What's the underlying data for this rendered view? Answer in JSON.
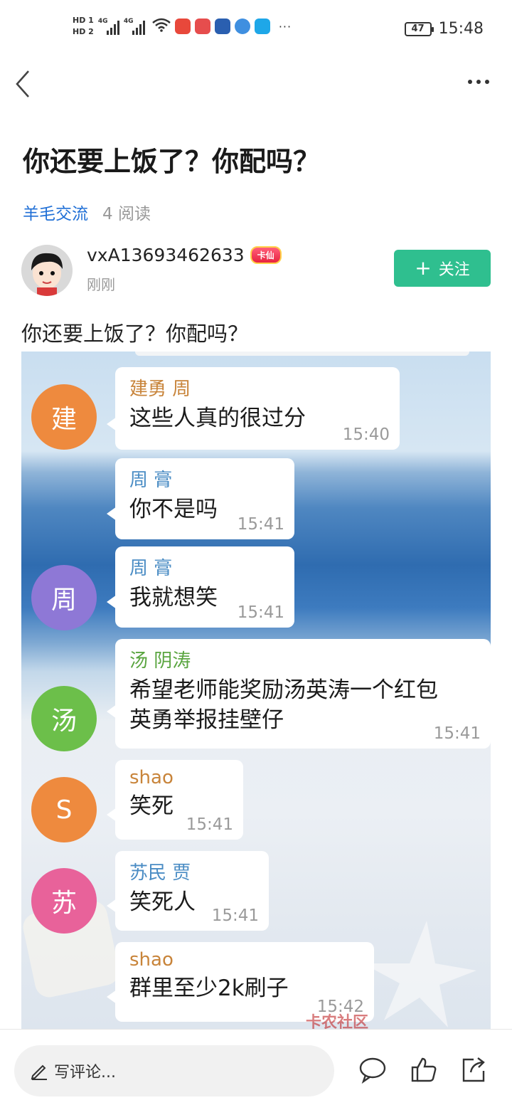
{
  "status_bar": {
    "hd1": "HD 1",
    "hd2": "HD 2",
    "net1": "4G",
    "net2": "4G",
    "battery": "47",
    "time": "15:48"
  },
  "article": {
    "title": "你还要上饭了？你配吗？",
    "category": "羊毛交流",
    "reads": "4 阅读",
    "author_name": "vxA13693462633",
    "author_badge": "卡仙",
    "post_time": "刚刚",
    "follow_label": "关注",
    "body_text": "你还要上饭了？你配吗？"
  },
  "chat": {
    "messages": [
      {
        "avatar": "建",
        "avatar_color": "#ee8a3e",
        "sender": "建勇 周",
        "sender_color": "#c8843a",
        "text": "这些人真的很过分",
        "time": "15:40"
      },
      {
        "avatar": "",
        "avatar_color": "",
        "sender": "周 膏",
        "sender_color": "#4a8cc4",
        "text": "你不是吗",
        "time": "15:41"
      },
      {
        "avatar": "周",
        "avatar_color": "#8e78d6",
        "sender": "周 膏",
        "sender_color": "#4a8cc4",
        "text": "我就想笑",
        "time": "15:41"
      },
      {
        "avatar": "汤",
        "avatar_color": "#6cbf4a",
        "sender": "汤 阴涛",
        "sender_color": "#5aa540",
        "text": "希望老师能奖励汤英涛一个红包",
        "text2": "英勇举报挂壁仔",
        "time": "15:41"
      },
      {
        "avatar": "S",
        "avatar_color": "#ee8a3e",
        "sender": "shao",
        "sender_color": "#c8843a",
        "text": "笑死",
        "time": "15:41"
      },
      {
        "avatar": "苏",
        "avatar_color": "#e8629a",
        "sender": "苏民 贾",
        "sender_color": "#4a8cc4",
        "text": "笑死人",
        "time": "15:41"
      },
      {
        "avatar": "",
        "avatar_color": "",
        "sender": "shao",
        "sender_color": "#c8843a",
        "text": "群里至少2k刷子",
        "time": "15:42"
      }
    ],
    "watermark": "卡农社区"
  },
  "bottom_bar": {
    "comment_placeholder": "写评论..."
  },
  "icons": [
    "back-icon",
    "more-icon",
    "edit-icon",
    "comment-icon",
    "like-icon",
    "share-icon",
    "wifi-icon",
    "battery-icon"
  ]
}
